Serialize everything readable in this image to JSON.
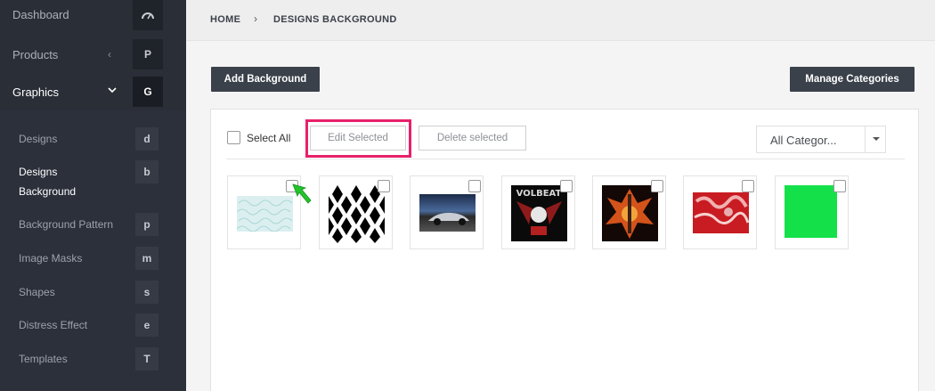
{
  "sidebar": {
    "top_items": [
      {
        "label": "Dashboard",
        "badge": "",
        "icon": "dashboard-icon"
      },
      {
        "label": "Products",
        "chevron": "‹",
        "badge": "P"
      },
      {
        "label": "Graphics",
        "chevron": "⌄",
        "badge": "G"
      }
    ],
    "sub_items": [
      {
        "label": "Designs",
        "badge": "d"
      },
      {
        "label": "Designs Background",
        "badge": "b"
      },
      {
        "label": "Background Pattern",
        "badge": "p"
      },
      {
        "label": "Image Masks",
        "badge": "m"
      },
      {
        "label": "Shapes",
        "badge": "s"
      },
      {
        "label": "Distress Effect",
        "badge": "e"
      },
      {
        "label": "Templates",
        "badge": "T"
      }
    ]
  },
  "breadcrumb": {
    "home": "HOME",
    "separator": "›",
    "current": "DESIGNS BACKGROUND"
  },
  "toolbar": {
    "add_label": "Add Background",
    "manage_label": "Manage Categories"
  },
  "panel": {
    "select_all_label": "Select All",
    "edit_selected_label": "Edit Selected",
    "delete_selected_label": "Delete selected",
    "category_value": "All Categor..."
  },
  "thumbnails": [
    {
      "name": "teal-floral-pattern"
    },
    {
      "name": "black-diamond-pattern"
    },
    {
      "name": "sports-car-on-road"
    },
    {
      "name": "volbeat-band-art"
    },
    {
      "name": "flaming-guitar-skull-art"
    },
    {
      "name": "red-tie-dye"
    },
    {
      "name": "green-solid"
    }
  ],
  "colors": {
    "sidebar_bg": "#2b303b",
    "dark_button": "#3b414b",
    "highlight": "#e8206a",
    "arrow": "#22c42a"
  }
}
